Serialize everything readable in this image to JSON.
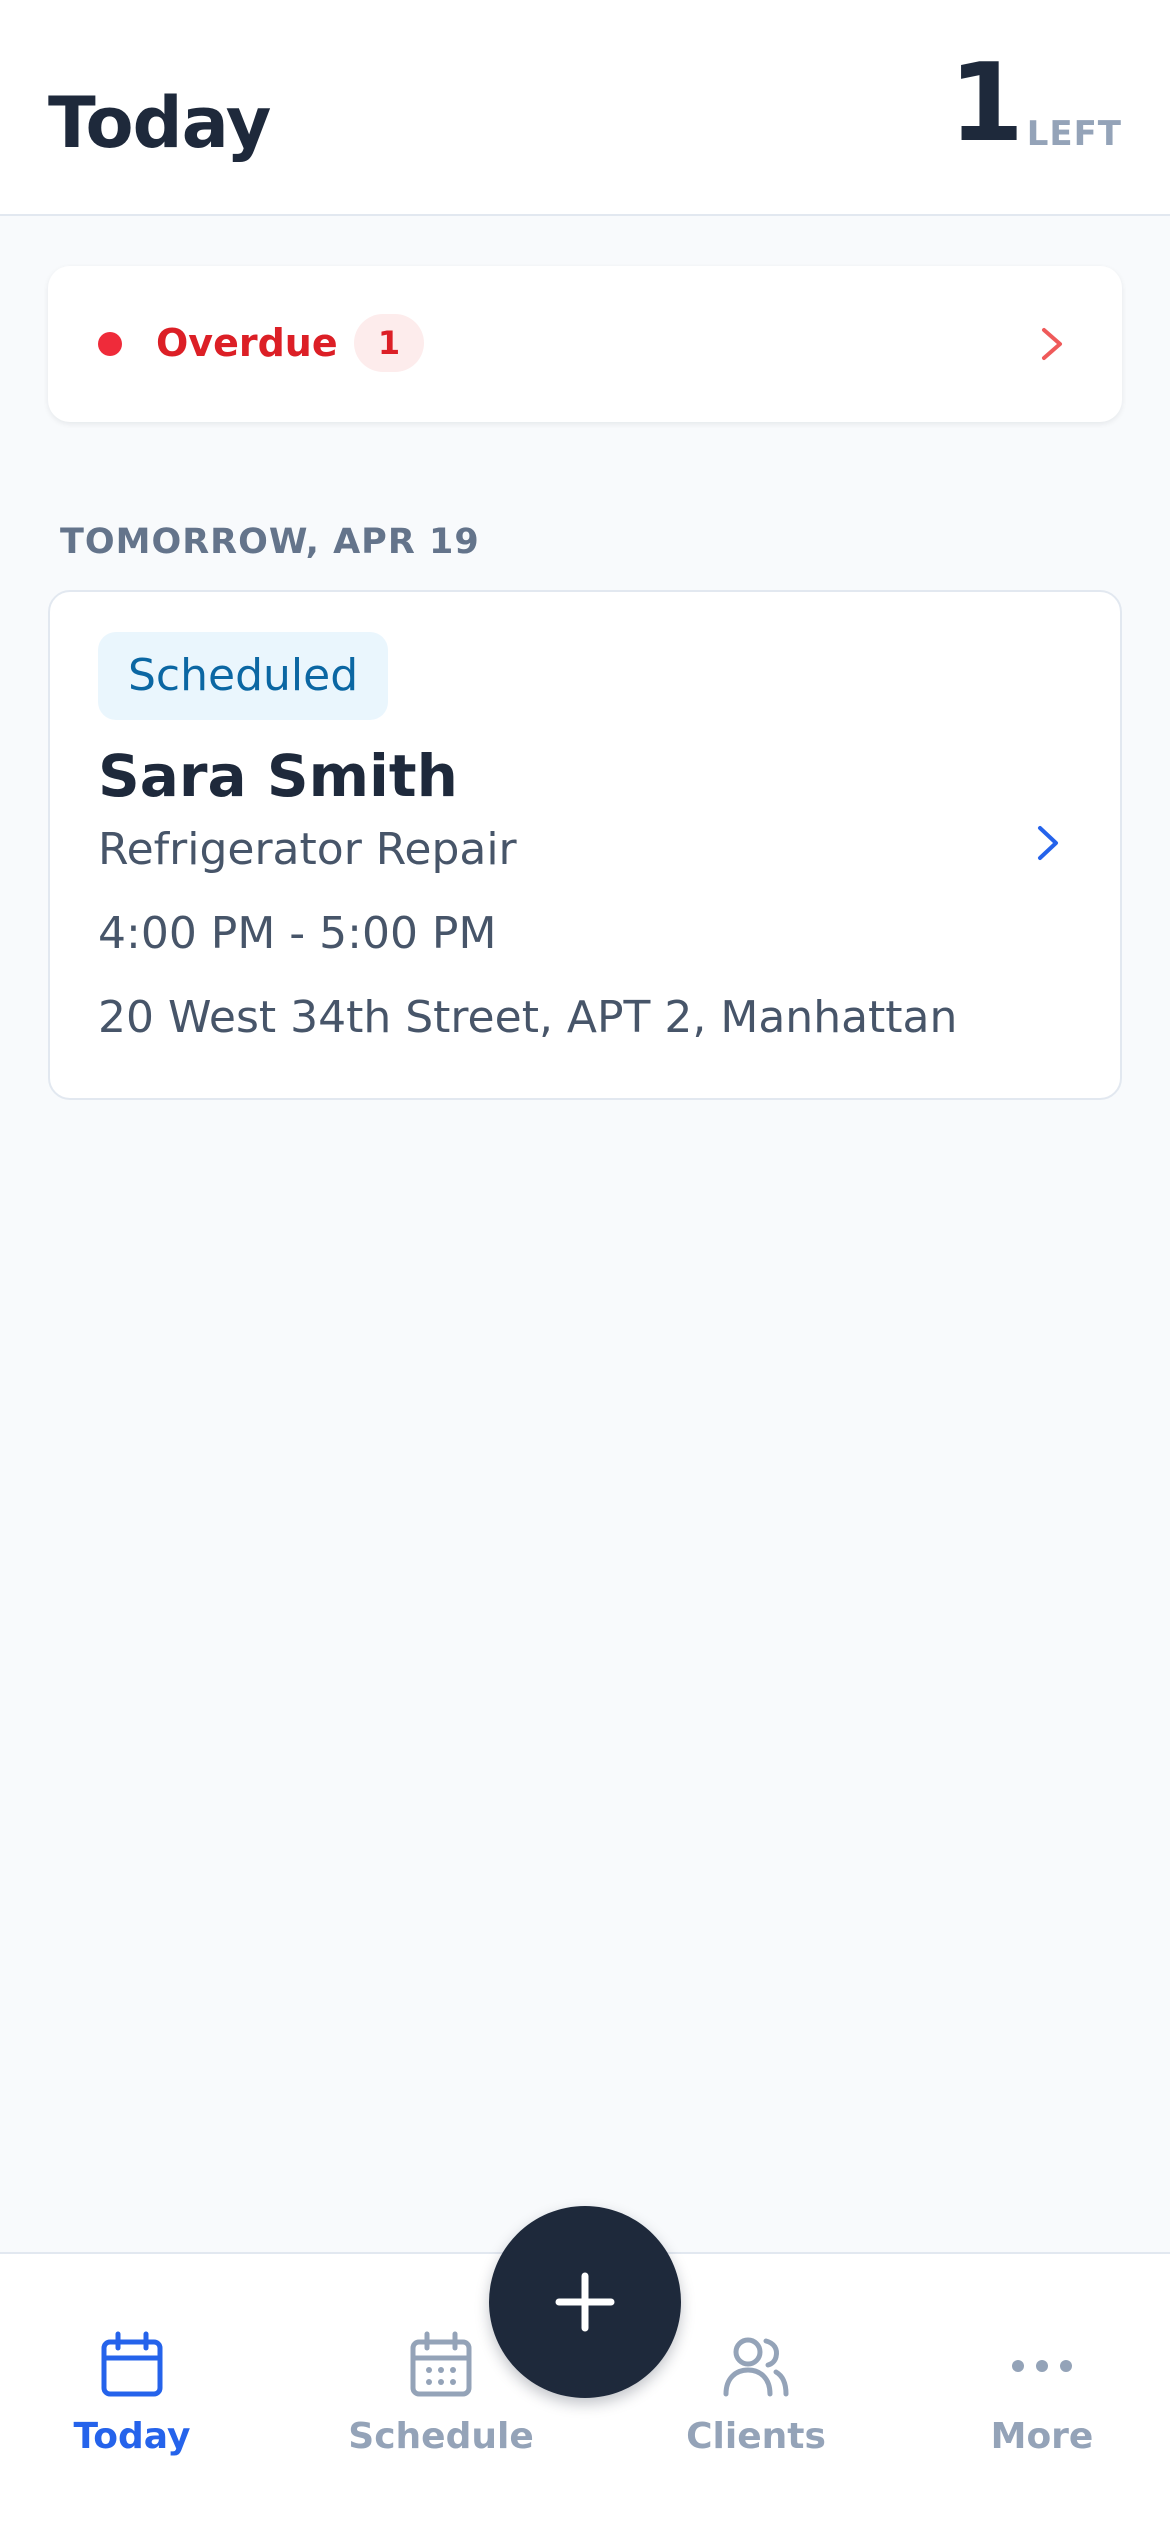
{
  "header": {
    "title": "Today",
    "remaining_count": "1",
    "remaining_label": "LEFT"
  },
  "overdue": {
    "label": "Overdue",
    "count": "1"
  },
  "section": {
    "label": "TOMORROW, APR 19"
  },
  "appointment": {
    "status": "Scheduled",
    "client_name": "Sara Smith",
    "service": "Refrigerator Repair",
    "time": "4:00 PM - 5:00 PM",
    "address": "20 West 34th Street, APT 2, Manhattan"
  },
  "nav": {
    "today": "Today",
    "schedule": "Schedule",
    "clients": "Clients",
    "more": "More"
  },
  "colors": {
    "accent": "#2563eb",
    "overdue": "#dc1f26",
    "scheduled_bg": "#eaf6fd",
    "scheduled_text": "#0b67a3",
    "fab": "#1e293b"
  },
  "icons": {
    "overdue_chevron": "chevron-right-icon",
    "appointment_chevron": "chevron-right-icon",
    "nav_today": "calendar-icon",
    "nav_schedule": "calendar-grid-icon",
    "nav_clients": "users-icon",
    "nav_more": "more-dots-icon",
    "fab": "plus-icon"
  }
}
